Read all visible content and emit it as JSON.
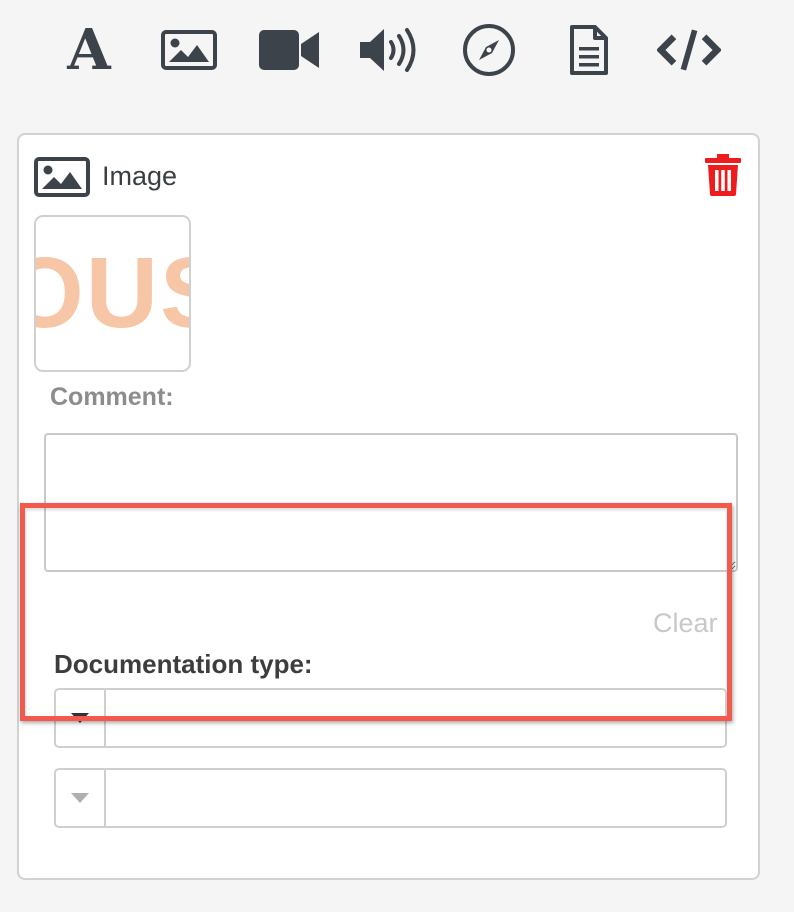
{
  "toolbar": {
    "items": [
      {
        "icon": "text-icon",
        "label": "A"
      },
      {
        "icon": "image-icon"
      },
      {
        "icon": "video-icon"
      },
      {
        "icon": "audio-icon"
      },
      {
        "icon": "compass-icon"
      },
      {
        "icon": "document-icon"
      },
      {
        "icon": "code-icon",
        "label": "</>"
      }
    ],
    "icon_color": "#3d434a"
  },
  "card": {
    "title": "Image",
    "header_icon": "image-icon",
    "delete_icon": "trash-icon",
    "delete_color": "#ee1c1c",
    "thumbnail_text": "OUS",
    "comment_label": "Comment:",
    "comment_value": "",
    "clear_label": "Clear",
    "documentation_type_label": "Documentation type:",
    "selects": [
      {
        "value": "",
        "arrow_color": "#2f3439"
      },
      {
        "value": "",
        "arrow_color": "#b0b0b0"
      }
    ],
    "highlight_color": "#f25a4d"
  }
}
